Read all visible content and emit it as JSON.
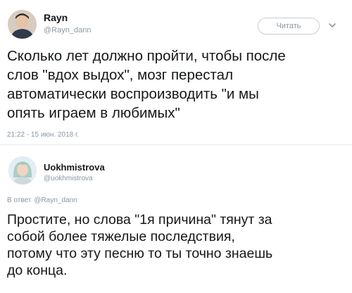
{
  "tweet": {
    "author_name": "Rayn",
    "author_handle": "@Rayn_dann",
    "follow_label": "Читать",
    "text": "Сколько лет должно пройти, чтобы после\nслов \"вдох выдох\", мозг перестал\nавтоматически воспроизводить \"и мы\nопять играем в любимых\"",
    "timestamp": "21:22 - 15 июн. 2018 г."
  },
  "reply": {
    "author_name": "Uokhmistrova",
    "author_handle": "@uokhmistrova",
    "in_reply_to_label": "В ответ",
    "in_reply_to_handle": "@Rayn_dann",
    "text": "Простите, но слова \"1я причина\" тянут за\nсобой более тяжелые последствия,\nпотому что эту песню то ты точно знаешь\nдо конца."
  },
  "colors": {
    "text": "#14171a",
    "secondary": "#8a96a3",
    "border": "#c7ced4"
  }
}
